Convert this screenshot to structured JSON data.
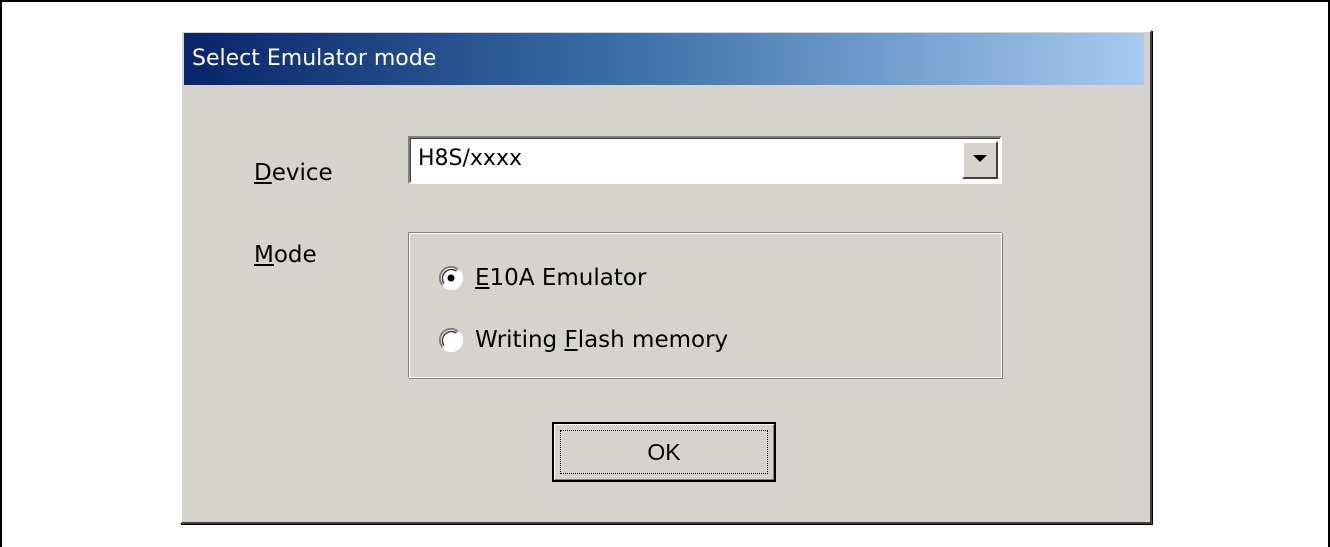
{
  "dialog": {
    "title": "Select Emulator mode"
  },
  "device": {
    "label_first": "D",
    "label_rest": "evice",
    "value": "H8S/xxxx"
  },
  "mode": {
    "label_first": "M",
    "label_rest": "ode",
    "options": [
      {
        "access_key": "E",
        "label_rest": "10A Emulator",
        "selected": true
      },
      {
        "label_prefix": "Writing ",
        "access_key": "F",
        "label_rest": "lash memory",
        "selected": false
      }
    ]
  },
  "ok_button": {
    "label": "OK"
  },
  "colors": {
    "dialog_face": "#d6d3ce",
    "titlebar_start": "#0a246a",
    "titlebar_end": "#a6caf0"
  },
  "icons": {
    "combo_arrow": "chevron-down-icon",
    "radio_selected": "radio-selected-icon",
    "radio_unselected": "radio-unselected-icon"
  }
}
